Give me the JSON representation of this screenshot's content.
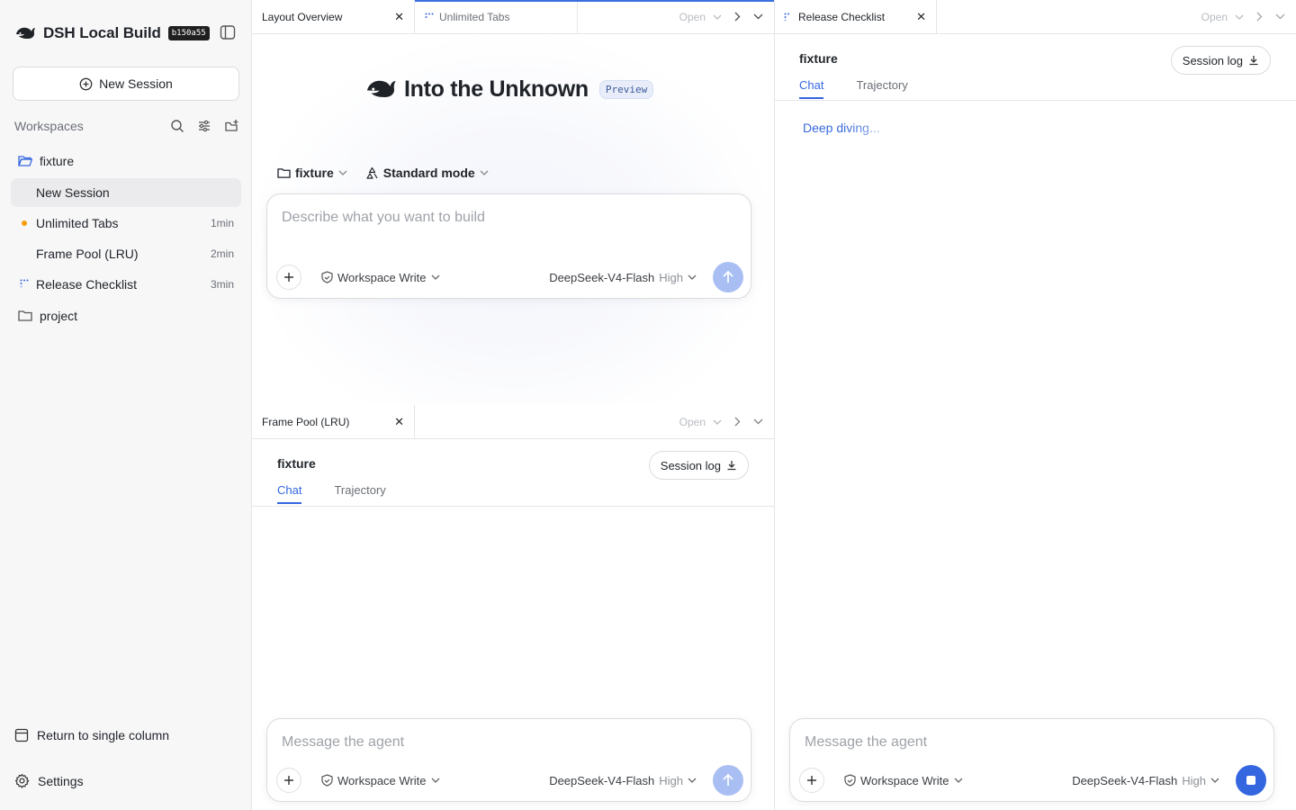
{
  "app": {
    "title": "DSH Local Build",
    "build": "b150a55"
  },
  "sidebar": {
    "new_session_label": "New Session",
    "workspaces_label": "Workspaces",
    "workspaces": [
      {
        "name": "fixture",
        "sessions": [
          {
            "title": "New Session",
            "time": ""
          },
          {
            "title": "Unlimited Tabs",
            "time": "1min"
          },
          {
            "title": "Frame Pool (LRU)",
            "time": "2min"
          },
          {
            "title": "Release Checklist",
            "time": "3min"
          }
        ]
      },
      {
        "name": "project"
      }
    ],
    "return_label": "Return to single column",
    "settings_label": "Settings"
  },
  "pane_top_left": {
    "tabs": [
      {
        "label": "Layout Overview"
      },
      {
        "label": "Unlimited Tabs"
      }
    ],
    "open_label": "Open",
    "hero_title": "Into the Unknown",
    "preview_badge": "Preview",
    "workspace_select": "fixture",
    "mode_select": "Standard mode",
    "composer": {
      "placeholder": "Describe what you want to build",
      "permission": "Workspace Write",
      "model": "DeepSeek-V4-Flash",
      "level": "High"
    }
  },
  "pane_bottom_left": {
    "tab": "Frame Pool (LRU)",
    "open_label": "Open",
    "workspace": "fixture",
    "session_log": "Session log",
    "subtabs": [
      "Chat",
      "Trajectory"
    ],
    "composer": {
      "placeholder": "Message the agent",
      "permission": "Workspace Write",
      "model": "DeepSeek-V4-Flash",
      "level": "High"
    }
  },
  "pane_right": {
    "tab": "Release Checklist",
    "open_label": "Open",
    "workspace": "fixture",
    "session_log": "Session log",
    "subtabs": [
      "Chat",
      "Trajectory"
    ],
    "status": "Deep diving...",
    "composer": {
      "placeholder": "Message the agent",
      "permission": "Workspace Write",
      "model": "DeepSeek-V4-Flash",
      "level": "High"
    }
  },
  "colors": {
    "accent": "#3466e0",
    "send_disabled": "#a9bff3",
    "unread_dot": "#f59e0b"
  }
}
